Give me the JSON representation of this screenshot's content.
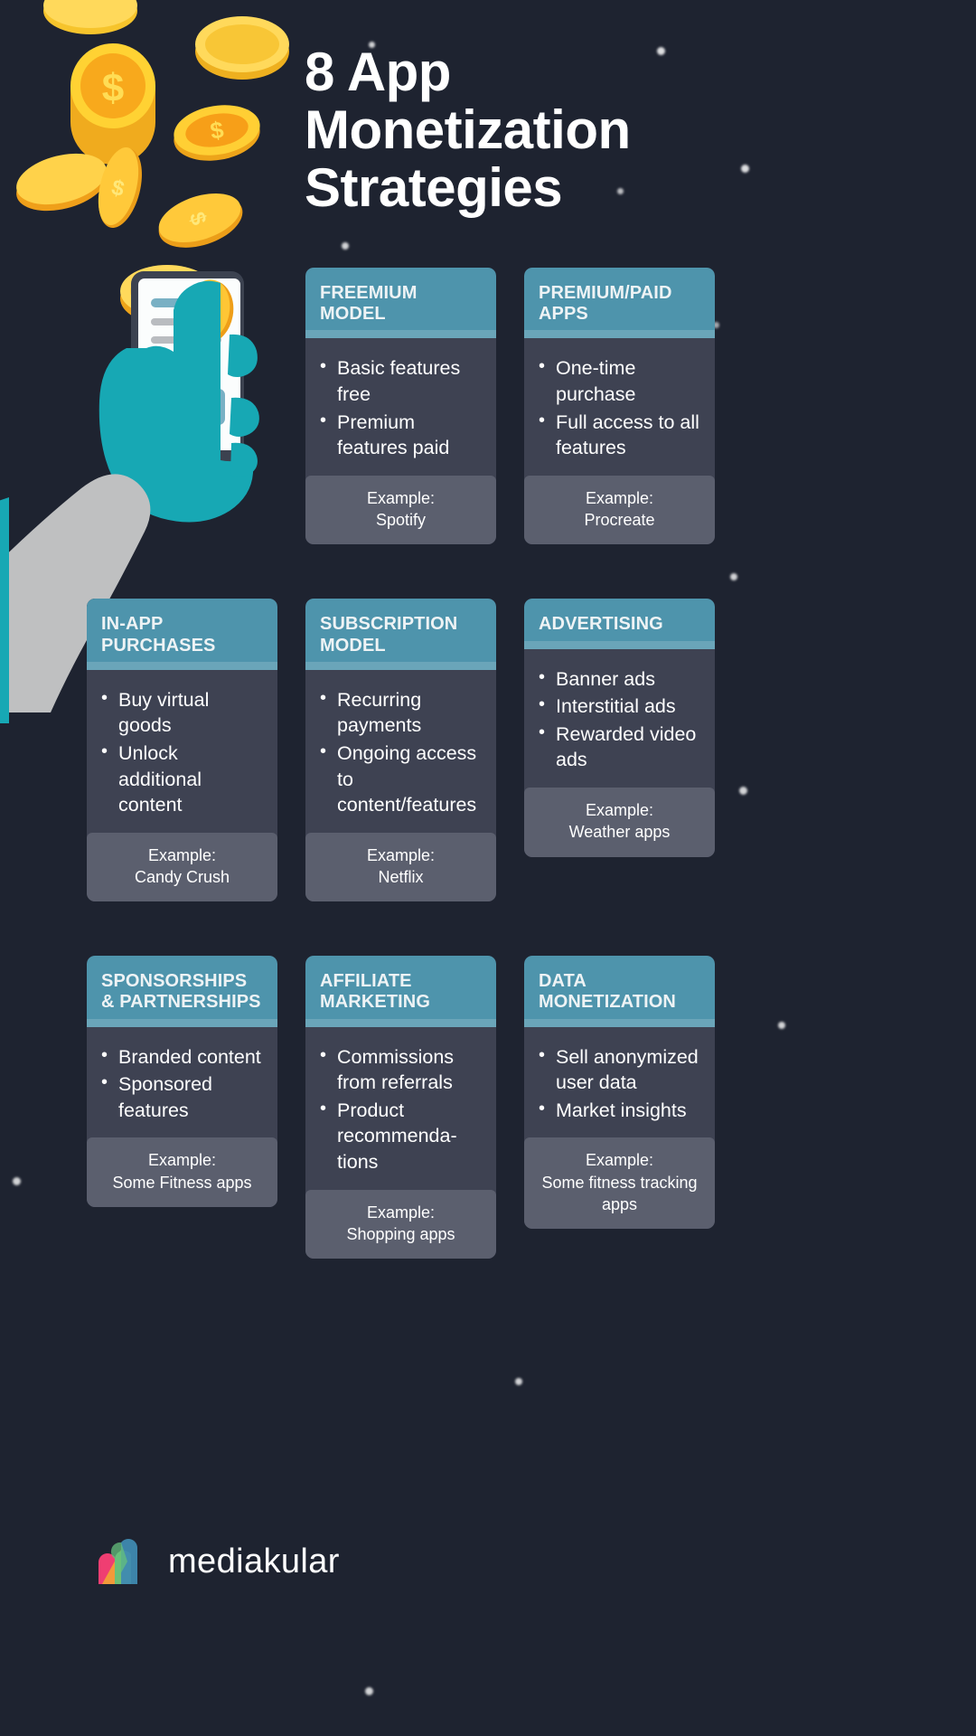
{
  "title": "8 App\nMonetization\nStrategies",
  "title_lines": [
    "8 App",
    "Monetization",
    "Strategies"
  ],
  "colors": {
    "background": "#1e2330",
    "card_header": "#4e94ac",
    "card_body": "#3e4252",
    "card_example": "#5b5f6e",
    "title_text": "#ffffff",
    "accent_teal": "#17a8b4",
    "coin_gold": "#f5c518"
  },
  "illustration": {
    "name": "hand-holding-phone-with-falling-coins",
    "coin_symbol": "$",
    "phone_play_icon": "play-icon"
  },
  "example_label": "Example:",
  "cards": [
    {
      "title": "FREEMIUM MODEL",
      "bullets": [
        "Basic features free",
        "Premium features paid"
      ],
      "example": "Spotify"
    },
    {
      "title": "PREMIUM/PAID APPS",
      "bullets": [
        "One-time purchase",
        "Full access to all features"
      ],
      "example": "Procreate"
    },
    {
      "title": "IN-APP PURCHASES",
      "bullets": [
        "Buy virtual goods",
        "Unlock additional content"
      ],
      "example": "Candy Crush"
    },
    {
      "title": "SUBSCRIPTION MODEL",
      "bullets": [
        "Recurring payments",
        "Ongoing access to content/features"
      ],
      "example": "Netflix"
    },
    {
      "title": "ADVERTISING",
      "bullets": [
        "Banner ads",
        "Interstitial ads",
        "Rewarded video ads"
      ],
      "example": "Weather apps"
    },
    {
      "title": "SPONSORSHIPS & PARTNERSHIPS",
      "bullets": [
        "Branded content",
        "Sponsored features"
      ],
      "example": "Some Fitness apps"
    },
    {
      "title": "AFFILIATE MARKETING",
      "bullets": [
        "Commissions from referrals",
        "Product recommenda-tions"
      ],
      "example": "Shopping apps"
    },
    {
      "title": "DATA MONETIZATION",
      "bullets": [
        "Sell anonymized user data",
        "Market insights"
      ],
      "example": "Some fitness tracking apps"
    }
  ],
  "footer": {
    "brand": "mediakular",
    "logo_icon": "mediakular-m-logo"
  }
}
